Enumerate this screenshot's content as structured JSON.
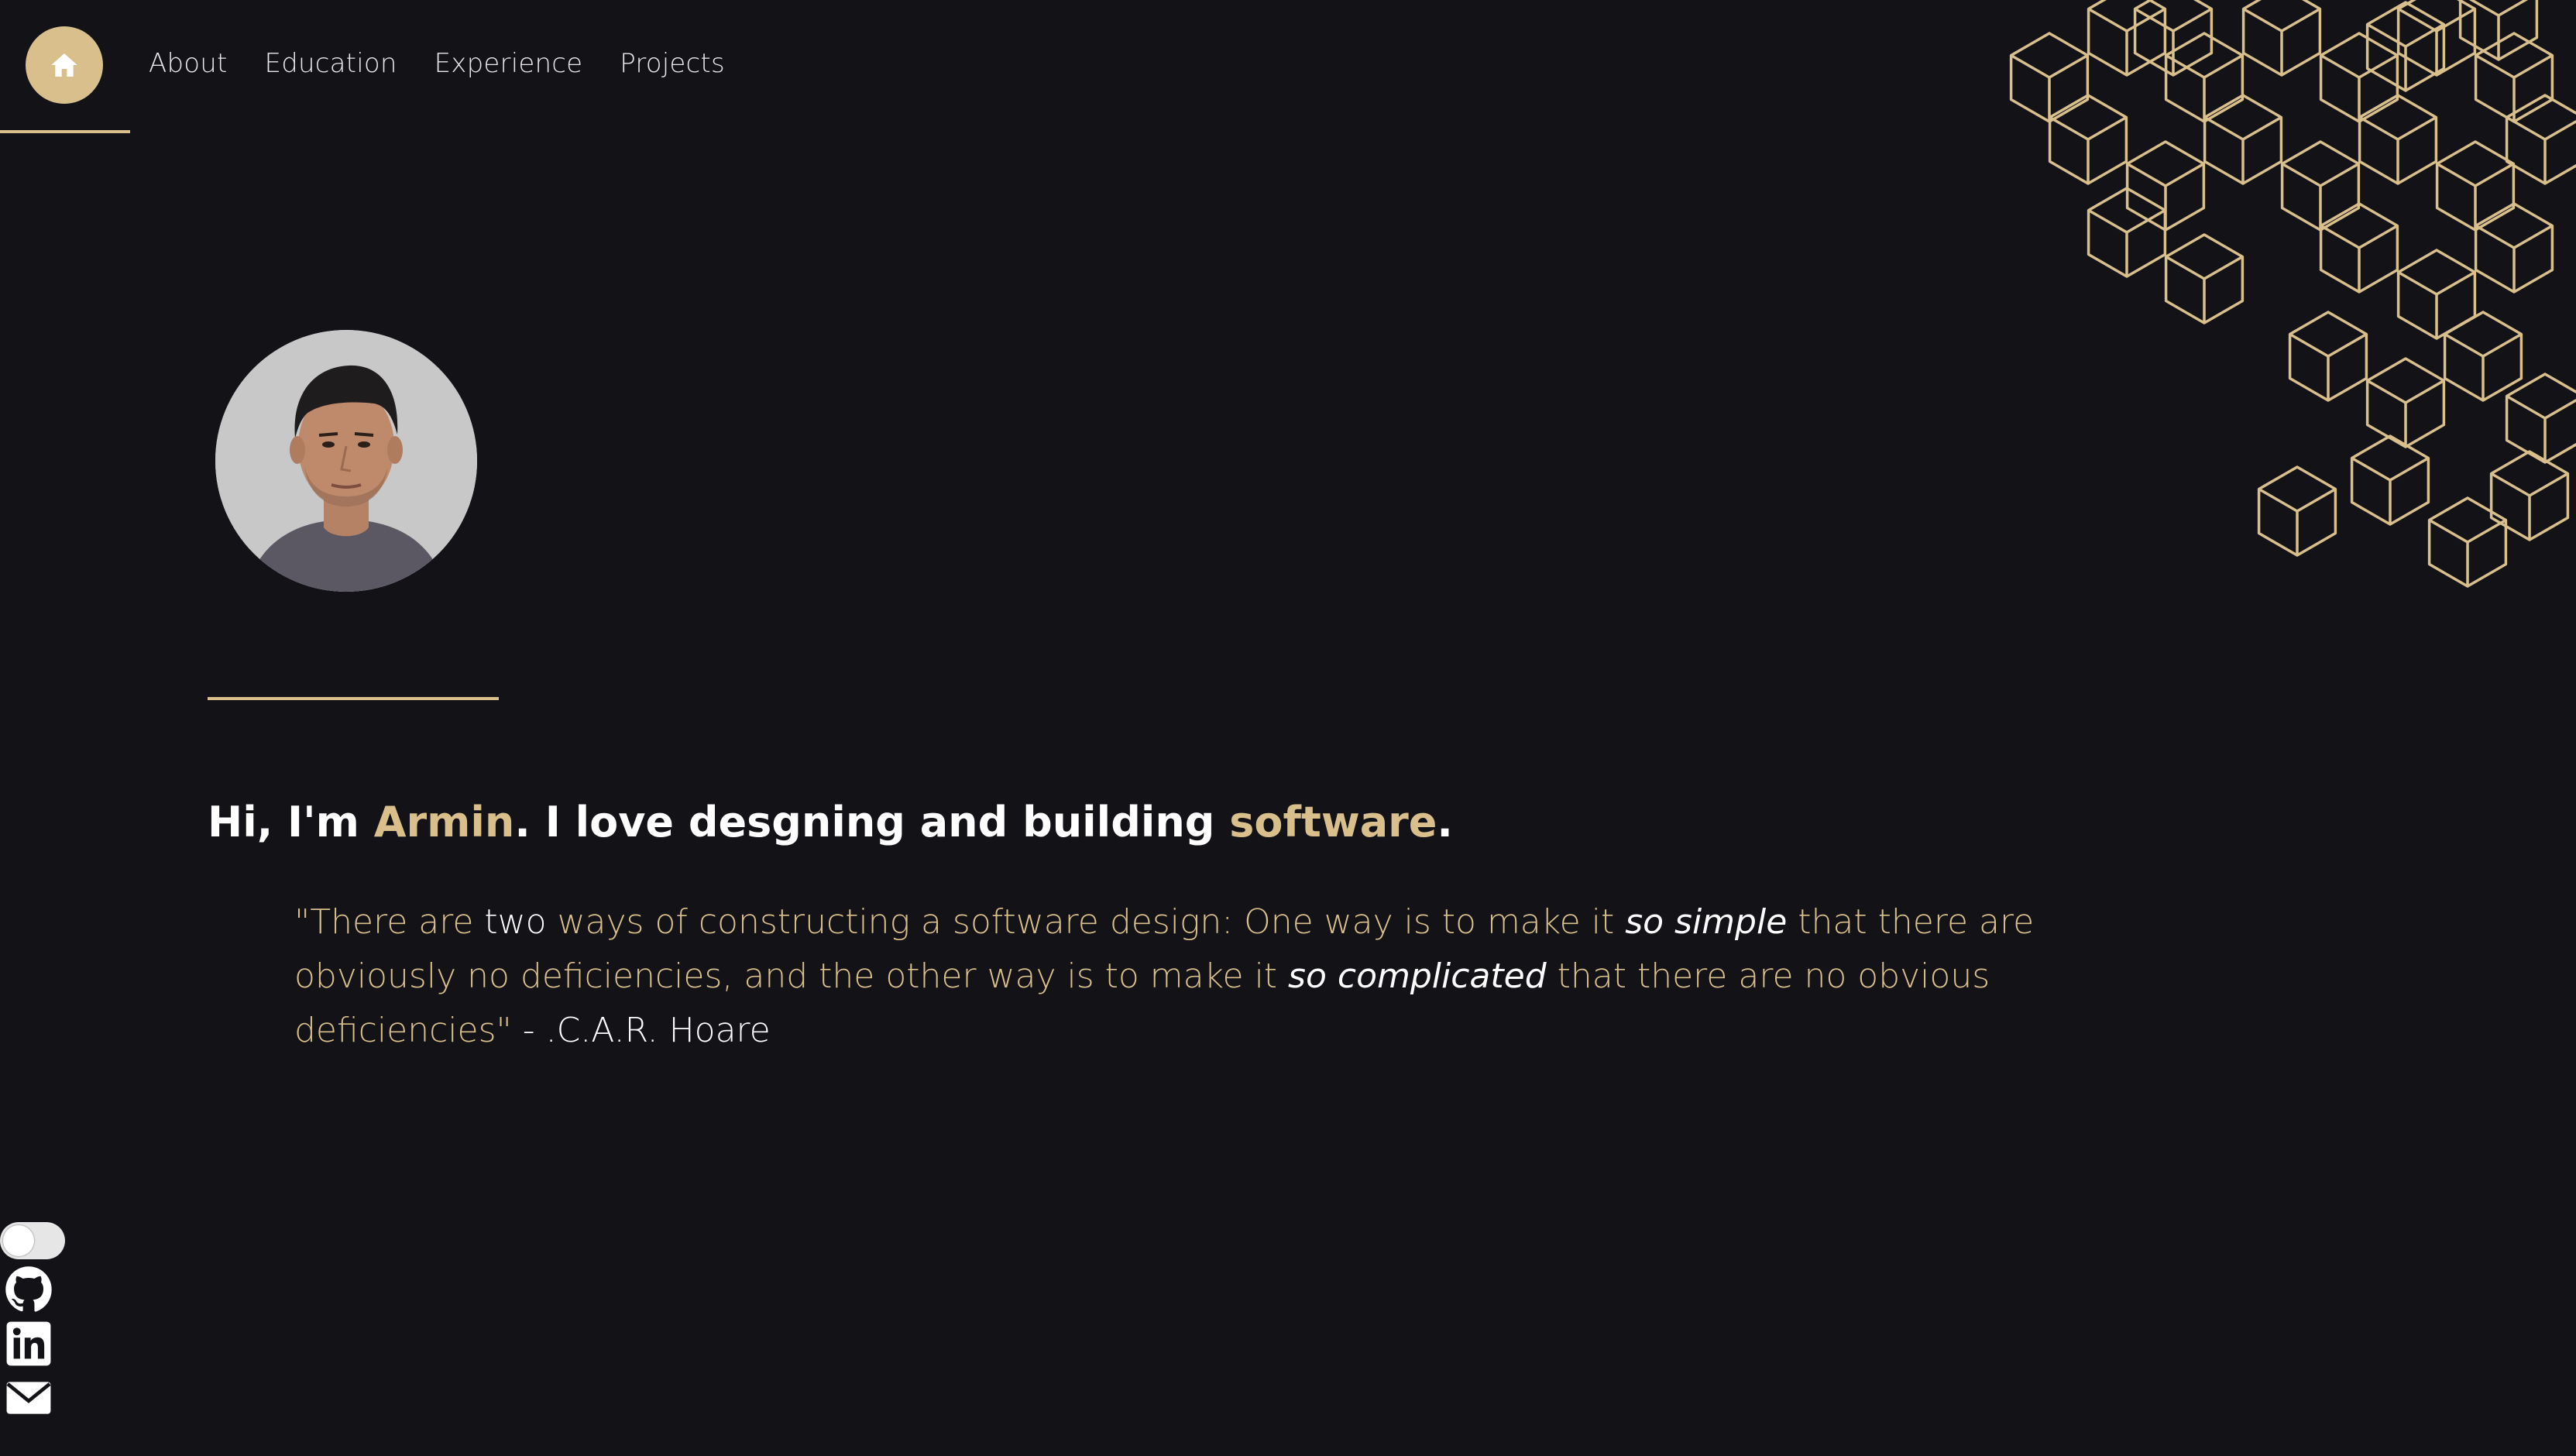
{
  "nav": {
    "home_icon": "home-icon",
    "links": [
      "About",
      "Education",
      "Experience",
      "Projects"
    ]
  },
  "hero": {
    "headline_pre": "Hi, I'm ",
    "name": "Armin",
    "headline_mid": ". I love desgning and building ",
    "highlight": "software",
    "headline_end": "."
  },
  "quote": {
    "part1": "\"There are ",
    "part2": "two",
    "part3": " ways of constructing a software design: One way is to make it ",
    "em1": "so simple",
    "part4": " that there are obviously no deficiencies, and the other way is to make it ",
    "em2": "so complicated",
    "part5": " that there are no obvious deficiencies\"",
    "author": " - .C.A.R. Hoare"
  },
  "social": {
    "icons": [
      "theme-toggle",
      "github-icon",
      "linkedin-icon",
      "mail-icon"
    ]
  },
  "colors": {
    "background": "#121217",
    "accent": "#d9bf8c",
    "text": "#ffffff"
  }
}
